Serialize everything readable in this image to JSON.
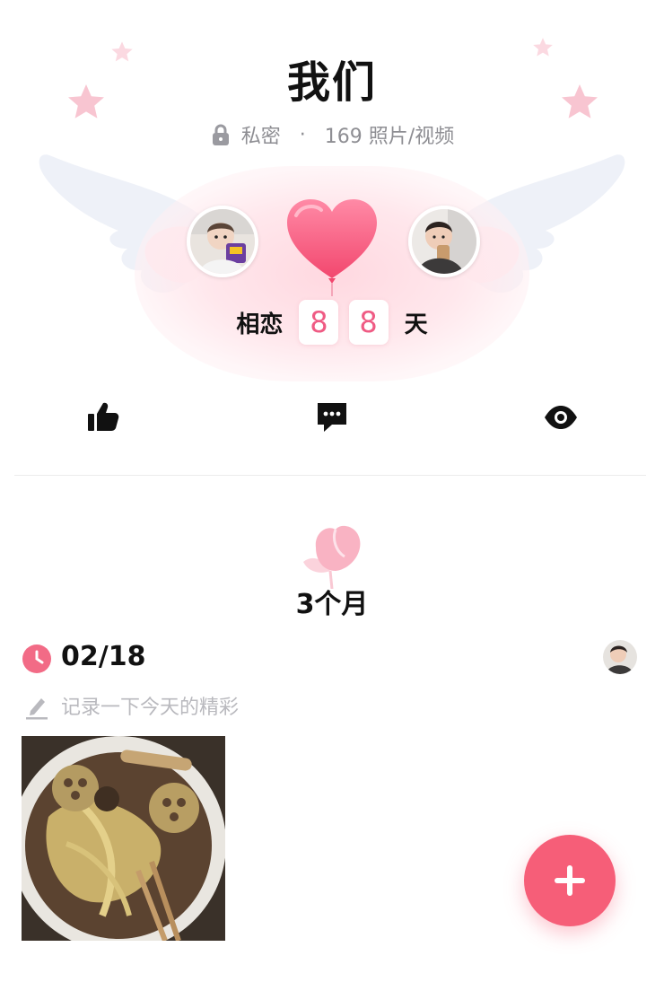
{
  "header": {
    "title": "我们",
    "privacy": "私密",
    "separator": "·",
    "media_count": "169 照片/视频"
  },
  "love_counter": {
    "prefix": "相恋",
    "digits": [
      "8",
      "8"
    ],
    "suffix": "天"
  },
  "actions": [
    {
      "name": "like",
      "icon": "thumbs-up-icon"
    },
    {
      "name": "comment",
      "icon": "chat-bubble-icon"
    },
    {
      "name": "views",
      "icon": "eye-icon"
    }
  ],
  "timeline": {
    "period": "3个月",
    "entry": {
      "date": "02/18",
      "placeholder": "记录一下今天的精彩"
    }
  },
  "fab": {
    "label": "+",
    "icon": "plus-icon"
  },
  "colors": {
    "accent": "#f65e78",
    "digit": "#ef5b84",
    "muted": "#8e8e93",
    "placeholder": "#b9b9be"
  }
}
